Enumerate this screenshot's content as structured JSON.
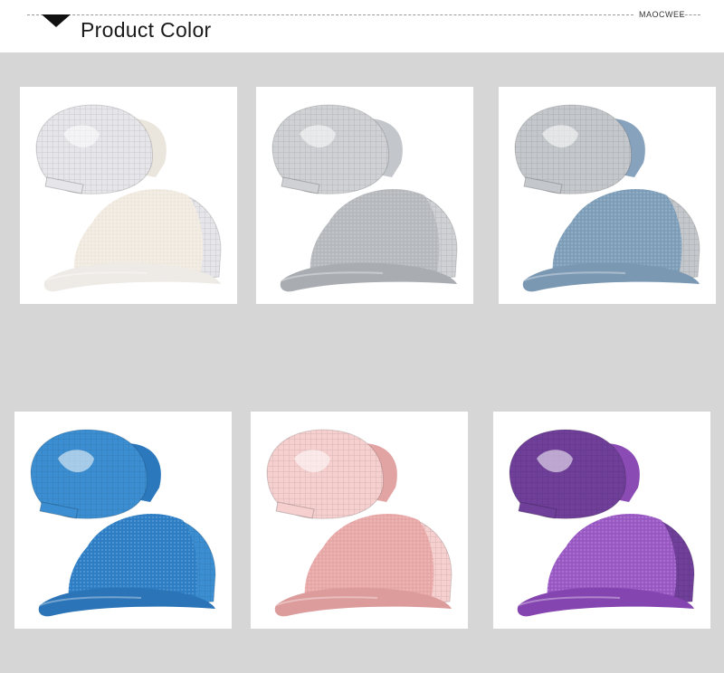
{
  "header": {
    "title": "Product Color",
    "brand": "MAOCWEE"
  },
  "products": [
    {
      "color": "white",
      "front": "#f1ebe1",
      "mesh": "#e6e6ea",
      "back": "#eae6de",
      "visor": "#eeebe6"
    },
    {
      "color": "silver",
      "front": "#b7babe",
      "mesh": "#cfd1d4",
      "back": "#c3c6ca",
      "visor": "#a9adb2"
    },
    {
      "color": "light-blue",
      "front": "#7f9fba",
      "mesh": "#c4c7cb",
      "back": "#86a2bc",
      "visor": "#7b98b3"
    },
    {
      "color": "blue",
      "front": "#2f7fc6",
      "mesh": "#3b8ed1",
      "back": "#2c78bd",
      "visor": "#2b74b7"
    },
    {
      "color": "pink",
      "front": "#e8a9a8",
      "mesh": "#f6cfcf",
      "back": "#e2a3a3",
      "visor": "#dc9c9c"
    },
    {
      "color": "purple",
      "front": "#9a59c4",
      "mesh": "#6f3f9a",
      "back": "#8b4bb5",
      "visor": "#8545b0"
    }
  ]
}
